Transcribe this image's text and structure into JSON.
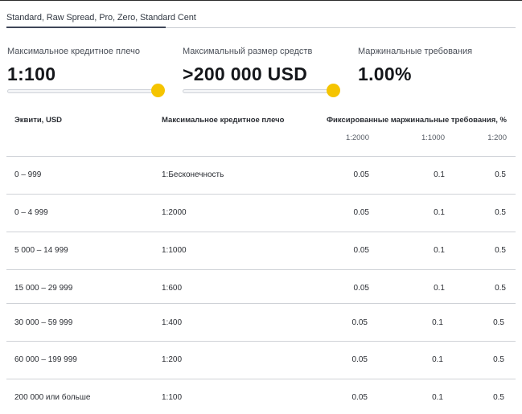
{
  "tabs": {
    "active_label": "Standard, Raw Spread, Pro, Zero, Standard Cent"
  },
  "stats": {
    "leverage": {
      "label": "Максимальное кредитное плечо",
      "value": "1:100",
      "slider_level": 1.0
    },
    "funds": {
      "label": "Максимальный размер средств",
      "value": ">200 000 USD",
      "slider_level": 1.0
    },
    "margin": {
      "label": "Маржинальные требования",
      "value": "1.00%"
    }
  },
  "table": {
    "headers": {
      "equity": "Эквити, USD",
      "leverage": "Максимальное кредитное плечо",
      "margin": "Фиксированные маржинальные требования, %"
    },
    "subheaders": [
      "1:2000",
      "1:1000",
      "1:200"
    ],
    "rows": [
      {
        "equity": "0 – 999",
        "leverage": "1:Бесконечность",
        "m1": "0.05",
        "m2": "0.1",
        "m3": "0.5"
      },
      {
        "equity": "0 – 4 999",
        "leverage": "1:2000",
        "m1": "0.05",
        "m2": "0.1",
        "m3": "0.5"
      },
      {
        "equity": "5 000 – 14 999",
        "leverage": "1:1000",
        "m1": "0.05",
        "m2": "0.1",
        "m3": "0.5"
      },
      {
        "equity": "15 000 – 29 999",
        "leverage": "1:600",
        "m1": "0.05",
        "m2": "0.1",
        "m3": "0.5"
      },
      {
        "equity": "30 000 – 59 999",
        "leverage": "1:400",
        "m1": "0.05",
        "m2": "0.1",
        "m3": "0.5"
      },
      {
        "equity": "60 000 – 199 999",
        "leverage": "1:200",
        "m1": "0.05",
        "m2": "0.1",
        "m3": "0.5"
      },
      {
        "equity": "200 000 или больше",
        "leverage": "1:100",
        "m1": "0.05",
        "m2": "0.1",
        "m3": "0.5"
      }
    ]
  },
  "colors": {
    "accent": "#f5c400",
    "text": "#1f2024",
    "divider": "#cfd2d7"
  }
}
